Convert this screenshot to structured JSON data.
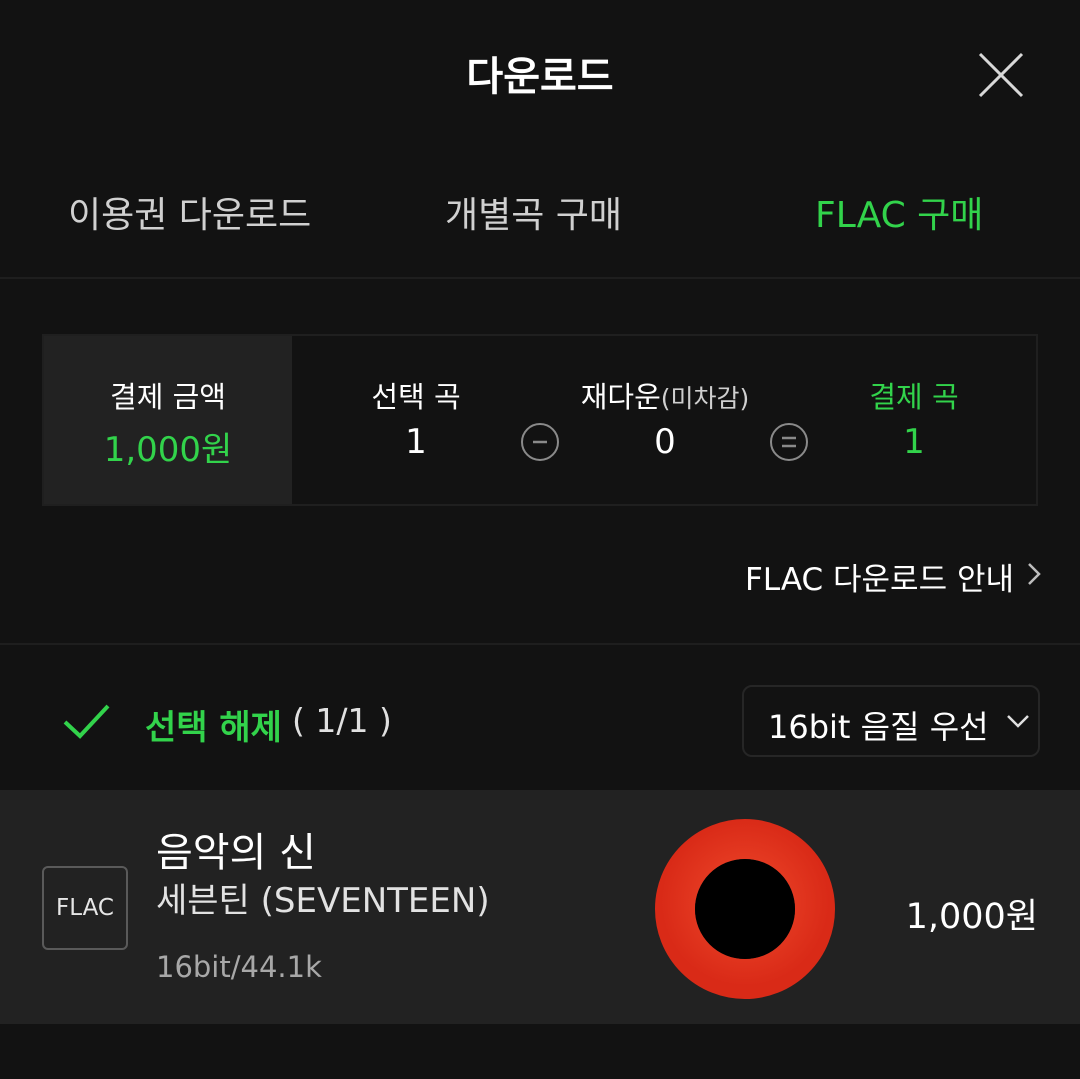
{
  "header": {
    "title": "다운로드",
    "close_icon": "close-icon"
  },
  "tabs": [
    {
      "label": "이용권 다운로드",
      "active": false
    },
    {
      "label": "개별곡 구매",
      "active": false
    },
    {
      "label": "FLAC 구매",
      "active": true
    }
  ],
  "summary": {
    "payment_amount_label": "결제 금액",
    "payment_amount_value": "1,000원",
    "selected_label": "선택 곡",
    "selected_value": "1",
    "redownload_label": "재다운",
    "redownload_sub": "(미차감)",
    "redownload_value": "0",
    "pay_songs_label": "결제 곡",
    "pay_songs_value": "1",
    "minus_icon": "minus-circle-icon",
    "equals_icon": "equals-circle-icon"
  },
  "guide_link": "FLAC 다운로드 안내",
  "selection": {
    "deselect_label": "선택 해제",
    "count_text": "( 1/1 )",
    "quality_option": "16bit 음질 우선"
  },
  "tracks": [
    {
      "badge": "FLAC",
      "title": "음악의 신",
      "artist": "세븐틴 (SEVENTEEN)",
      "format": "16bit/44.1k",
      "price": "1,000원"
    }
  ],
  "colors": {
    "accent": "#32d34b",
    "background": "#121212",
    "row": "#222222",
    "album_red": "#e8321f"
  }
}
